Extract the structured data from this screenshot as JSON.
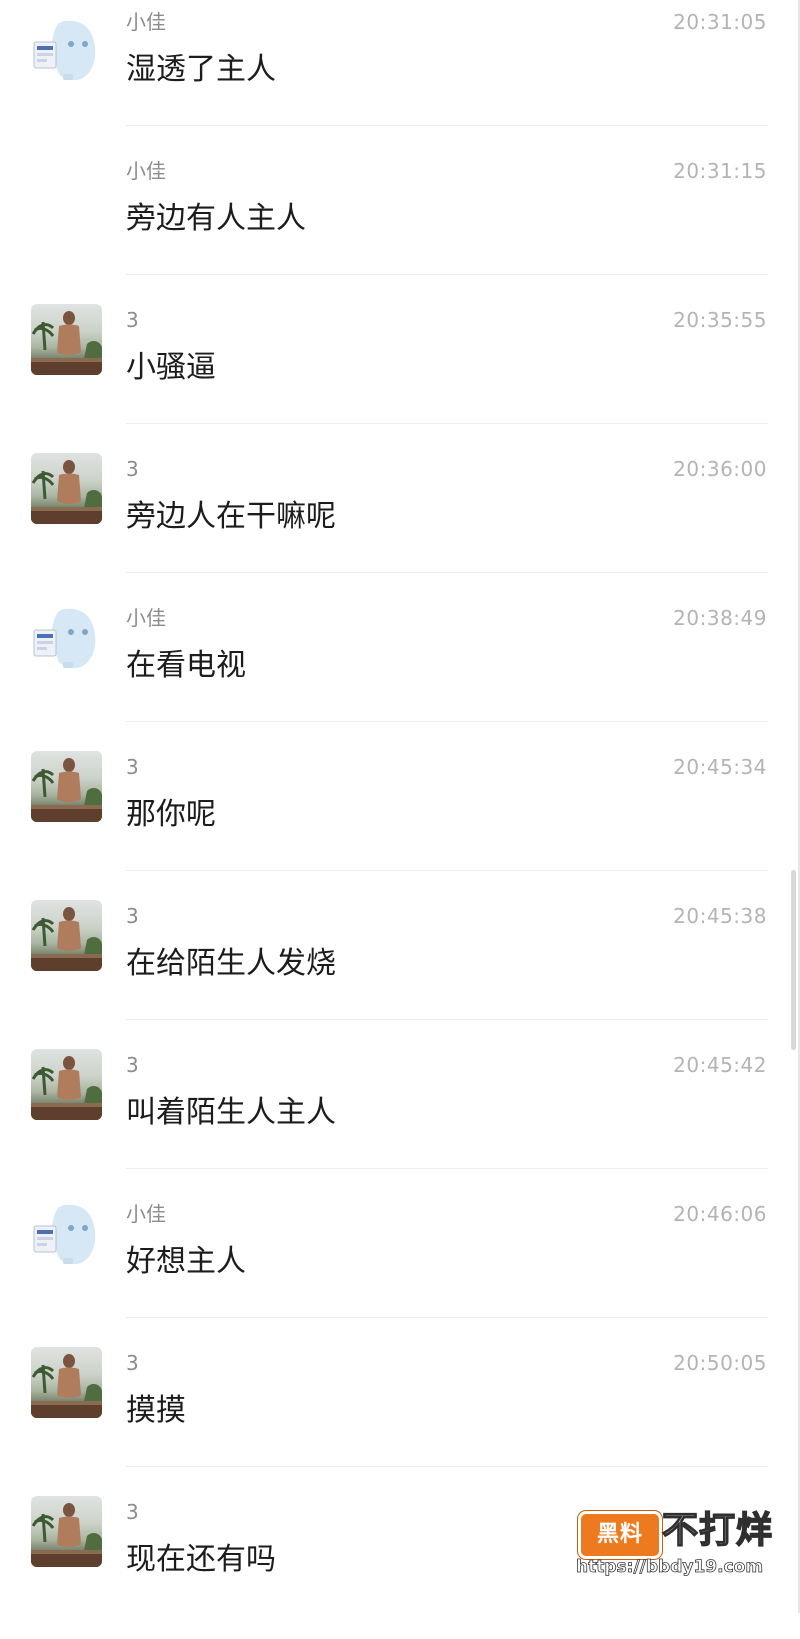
{
  "messages": [
    {
      "sender": "小佳",
      "time": "20:31:05",
      "text": "湿透了主人",
      "avatar": "ghost-avatar",
      "show_avatar": true
    },
    {
      "sender": "小佳",
      "time": "20:31:15",
      "text": "旁边有人主人",
      "avatar": "ghost-avatar",
      "show_avatar": false
    },
    {
      "sender": "3",
      "time": "20:35:55",
      "text": "小骚逼",
      "avatar": "photo-avatar",
      "show_avatar": true
    },
    {
      "sender": "3",
      "time": "20:36:00",
      "text": "旁边人在干嘛呢",
      "avatar": "photo-avatar",
      "show_avatar": true
    },
    {
      "sender": "小佳",
      "time": "20:38:49",
      "text": "在看电视",
      "avatar": "ghost-avatar",
      "show_avatar": true
    },
    {
      "sender": "3",
      "time": "20:45:34",
      "text": "那你呢",
      "avatar": "photo-avatar",
      "show_avatar": true
    },
    {
      "sender": "3",
      "time": "20:45:38",
      "text": "在给陌生人发烧",
      "avatar": "photo-avatar",
      "show_avatar": true
    },
    {
      "sender": "3",
      "time": "20:45:42",
      "text": "叫着陌生人主人",
      "avatar": "photo-avatar",
      "show_avatar": true
    },
    {
      "sender": "小佳",
      "time": "20:46:06",
      "text": "好想主人",
      "avatar": "ghost-avatar",
      "show_avatar": true
    },
    {
      "sender": "3",
      "time": "20:50:05",
      "text": "摸摸",
      "avatar": "photo-avatar",
      "show_avatar": true
    },
    {
      "sender": "3",
      "time": "",
      "text": "现在还有吗",
      "avatar": "photo-avatar",
      "show_avatar": true
    }
  ],
  "watermark": {
    "badge": "黑料",
    "title": "不打烊",
    "url": "https://bbdy19.com"
  }
}
